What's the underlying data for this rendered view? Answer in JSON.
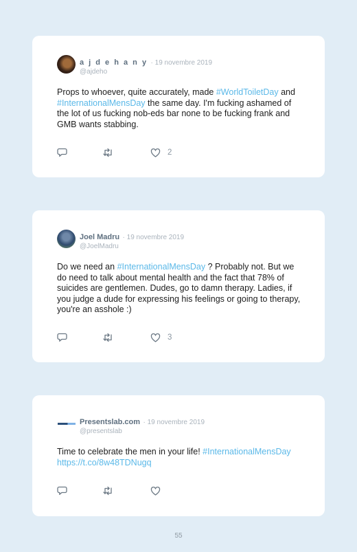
{
  "tweets": [
    {
      "name": "a j d e h a n y",
      "date": "· 19 novembre 2019",
      "handle": "@ajdeho",
      "text_parts": [
        "Props to whoever, quite accurately, made ",
        "#WorldToiletDay",
        " and ",
        "#InternationalMensDay",
        " the same day. I'm fucking ashamed of the lot of us fucking nob-eds bar none to be fucking frank and GMB wants stabbing."
      ],
      "likes": "2"
    },
    {
      "name": "Joel Madru",
      "date": "· 19 novembre 2019",
      "handle": "@JoelMadru",
      "text_parts": [
        "Do we need an ",
        "#InternationalMensDay",
        " ? Probably not. But we do need to talk about mental health and the fact that 78% of suicides are gentlemen. Dudes, go to damn therapy. Ladies, if you judge a dude for expressing his feelings or going to therapy, you're an asshole :)"
      ],
      "likes": "3"
    },
    {
      "name": "Presentslab.com",
      "date": "· 19 novembre 2019",
      "handle": "@presentslab",
      "text_parts": [
        "Time to celebrate the men in your life! ",
        "#InternationalMensDay",
        " ",
        "https://t.co/8w48TDNugq"
      ],
      "likes": ""
    }
  ],
  "page_number": "55",
  "icons": {
    "reply": "reply-icon",
    "retweet": "retweet-icon",
    "like": "heart-icon"
  },
  "colors": {
    "background": "#e1edf6",
    "hashtag": "#5ab8e8",
    "name": "#5e6f7f",
    "muted": "#aab3bc"
  }
}
